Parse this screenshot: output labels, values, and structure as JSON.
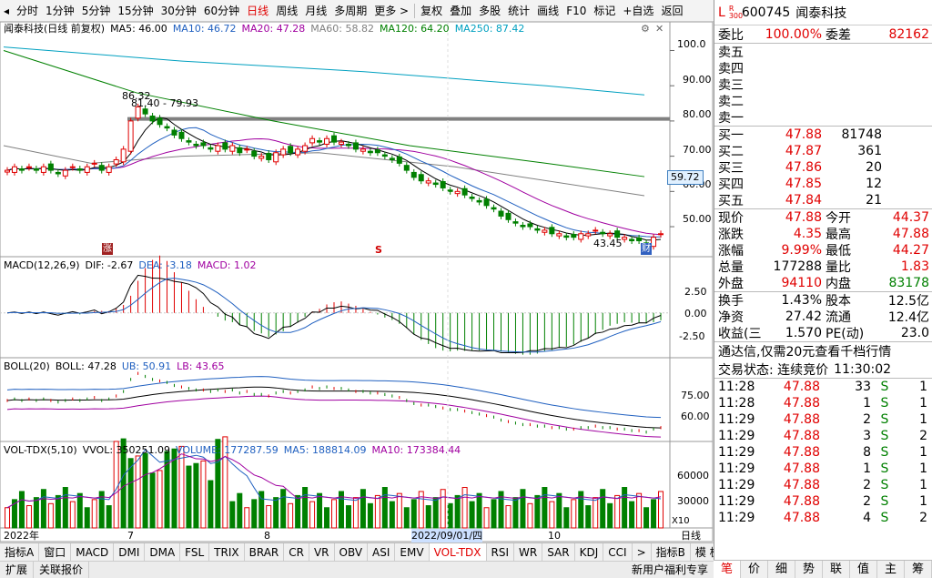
{
  "toolbar": {
    "back_arrow": "◂",
    "periods": [
      "分时",
      "1分钟",
      "5分钟",
      "15分钟",
      "30分钟",
      "60分钟",
      "日线",
      "周线",
      "月线",
      "多周期",
      "更多 >"
    ],
    "active_period": "日线",
    "tools": [
      "复权",
      "叠加",
      "多股",
      "统计",
      "画线",
      "F10",
      "标记",
      "+自选",
      "返回"
    ]
  },
  "chart": {
    "title": "闻泰科技(日线 前复权)",
    "ma_labels": [
      {
        "text": "MA5: 46.00",
        "color": "#000000"
      },
      {
        "text": "MA10: 46.72",
        "color": "#2060c0"
      },
      {
        "text": "MA20: 47.28",
        "color": "#a000a0"
      },
      {
        "text": "MA60: 58.82",
        "color": "#808080"
      },
      {
        "text": "MA120: 64.20",
        "color": "#008000"
      },
      {
        "text": "MA250: 87.42",
        "color": "#00a0c0"
      }
    ],
    "price_axis": [
      "100.0",
      "90.00",
      "80.00",
      "70.00",
      "60.00",
      "50.00"
    ],
    "current_tag": "59.72",
    "high_label": "86.32",
    "line_label": "81.40 - 79.93",
    "low_label": "43.45",
    "cai_badge": "财",
    "zhang_badge": "涨",
    "s_badge": "S",
    "macd_label": "MACD(12,26,9)",
    "macd_vals": [
      {
        "text": "DIF: -2.67",
        "color": "#000000"
      },
      {
        "text": "DEA: -3.18",
        "color": "#2060c0"
      },
      {
        "text": "MACD: 1.02",
        "color": "#a000a0"
      }
    ],
    "macd_axis": [
      "2.50",
      "0.00",
      "-2.50"
    ],
    "boll_label": "BOLL(20)",
    "boll_vals": [
      {
        "text": "BOLL: 47.28",
        "color": "#000000"
      },
      {
        "text": "UB: 50.91",
        "color": "#2060c0"
      },
      {
        "text": "LB: 43.65",
        "color": "#a000a0"
      }
    ],
    "boll_axis": [
      "75.00",
      "60.00"
    ],
    "vol_label": "VOL-TDX(5,10)",
    "vol_vals": [
      {
        "text": "VVOL: 350251.09",
        "color": "#000000"
      },
      {
        "text": "VOLUME: 177287.59",
        "color": "#2060c0"
      },
      {
        "text": "MA5: 188814.09",
        "color": "#2060c0"
      },
      {
        "text": "MA10: 173384.44",
        "color": "#a000a0"
      }
    ],
    "vol_axis": [
      "60000",
      "30000"
    ],
    "vol_unit": "X10",
    "date_axis": [
      "2022年",
      "7",
      "8",
      "2022/09/01/四",
      "10"
    ],
    "date_axis_right": "日线"
  },
  "bottom_tabs": [
    "指标A",
    "窗口",
    "MACD",
    "DMI",
    "DMA",
    "FSL",
    "TRIX",
    "BRAR",
    "CR",
    "VR",
    "OBV",
    "ASI",
    "EMV",
    "VOL-TDX",
    "RSI",
    "WR",
    "SAR",
    "KDJ",
    "CCI",
    ">",
    "指标B",
    "模 板",
    "+"
  ],
  "active_tab": "VOL-TDX",
  "status_bar": [
    "扩展",
    "关联报价"
  ],
  "status_right": "新用户福利专享",
  "quote": {
    "market_flag": "L",
    "r300": "R\n300",
    "code": "600745",
    "name": "闻泰科技",
    "weibi_label": "委比",
    "weibi": "100.00%",
    "weicha_label": "委差",
    "weicha": "82162",
    "asks": [
      "卖五",
      "卖四",
      "卖三",
      "卖二",
      "卖一"
    ],
    "bids": [
      {
        "label": "买一",
        "price": "47.88",
        "vol": "81748"
      },
      {
        "label": "买二",
        "price": "47.87",
        "vol": "361"
      },
      {
        "label": "买三",
        "price": "47.86",
        "vol": "20"
      },
      {
        "label": "买四",
        "price": "47.85",
        "vol": "12"
      },
      {
        "label": "买五",
        "price": "47.84",
        "vol": "21"
      }
    ],
    "stats": [
      {
        "l1": "现价",
        "v1": "47.88",
        "c1": "red",
        "l2": "今开",
        "v2": "44.37",
        "c2": "red"
      },
      {
        "l1": "涨跌",
        "v1": "4.35",
        "c1": "red",
        "l2": "最高",
        "v2": "47.88",
        "c2": "red"
      },
      {
        "l1": "涨幅",
        "v1": "9.99%",
        "c1": "red",
        "l2": "最低",
        "v2": "44.27",
        "c2": "red"
      },
      {
        "l1": "总量",
        "v1": "177288",
        "c1": "black",
        "l2": "量比",
        "v2": "1.83",
        "c2": "red"
      },
      {
        "l1": "外盘",
        "v1": "94110",
        "c1": "red",
        "l2": "内盘",
        "v2": "83178",
        "c2": "green"
      }
    ],
    "stats2": [
      {
        "l1": "换手",
        "v1": "1.43%",
        "l2": "股本",
        "v2": "12.5亿"
      },
      {
        "l1": "净资",
        "v1": "27.42",
        "l2": "流通",
        "v2": "12.4亿"
      },
      {
        "l1": "收益(三)",
        "v1": "1.570",
        "l2": "PE(动)",
        "v2": "23.0"
      }
    ],
    "notice": "通达信,仅需20元查看千档行情",
    "trade_status_label": "交易状态: 连续竞价",
    "trade_time": "11:30:02",
    "ticks": [
      {
        "t": "11:28",
        "p": "47.88",
        "v": "33",
        "s": "S",
        "n": "1"
      },
      {
        "t": "11:28",
        "p": "47.88",
        "v": "1",
        "s": "S",
        "n": "1"
      },
      {
        "t": "11:29",
        "p": "47.88",
        "v": "2",
        "s": "S",
        "n": "1"
      },
      {
        "t": "11:29",
        "p": "47.88",
        "v": "3",
        "s": "S",
        "n": "2"
      },
      {
        "t": "11:29",
        "p": "47.88",
        "v": "8",
        "s": "S",
        "n": "1"
      },
      {
        "t": "11:29",
        "p": "47.88",
        "v": "1",
        "s": "S",
        "n": "1"
      },
      {
        "t": "11:29",
        "p": "47.88",
        "v": "2",
        "s": "S",
        "n": "1"
      },
      {
        "t": "11:29",
        "p": "47.88",
        "v": "2",
        "s": "S",
        "n": "1"
      },
      {
        "t": "11:29",
        "p": "47.88",
        "v": "4",
        "s": "S",
        "n": "2"
      }
    ]
  },
  "right_tabs": [
    "笔",
    "价",
    "细",
    "势",
    "联",
    "值",
    "主",
    "筹"
  ],
  "active_right_tab": "笔",
  "chart_data": {
    "type": "candlestick",
    "ylim": [
      42,
      104
    ],
    "closes": [
      66,
      67,
      66,
      67,
      66,
      67,
      66,
      65,
      66,
      67,
      66,
      67,
      68,
      66,
      67,
      69,
      72,
      80,
      84,
      82,
      80,
      79,
      78,
      76,
      75,
      74,
      73,
      73,
      72,
      73,
      72,
      73,
      71,
      72,
      70,
      70,
      69,
      71,
      72,
      71,
      72,
      73,
      75,
      74,
      75,
      74,
      74,
      73,
      72,
      72,
      71,
      71,
      70,
      69,
      68,
      66,
      64,
      63,
      63,
      62,
      61,
      60,
      60,
      59,
      58,
      57,
      56,
      55,
      53,
      52,
      51,
      50,
      50,
      49,
      49,
      48,
      48,
      47,
      47,
      48,
      48,
      49,
      48,
      48,
      47,
      47,
      46,
      46,
      45,
      47,
      48
    ]
  }
}
